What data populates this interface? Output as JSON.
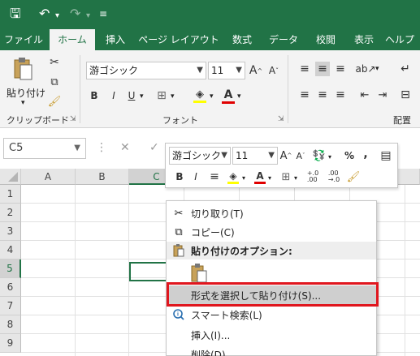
{
  "tabs": [
    "ファイル",
    "ホーム",
    "挿入",
    "ページ レイアウト",
    "数式",
    "データ",
    "校閲",
    "表示",
    "ヘルプ"
  ],
  "ribbon": {
    "paste_label": "貼り付け",
    "clipboard_group": "クリップボード",
    "font_group": "フォント",
    "align_group": "配置",
    "font_name": "游ゴシック",
    "font_size": "11",
    "bold": "B",
    "italic": "I",
    "underline": "U",
    "grow": "A",
    "shrink": "A"
  },
  "formula_bar": {
    "name_box": "C5"
  },
  "grid": {
    "columns": [
      "A",
      "B",
      "C"
    ],
    "rows": [
      "1",
      "2",
      "3",
      "4",
      "5",
      "6",
      "7",
      "8",
      "9"
    ],
    "selected_column": "C",
    "selected_row": "5"
  },
  "mini_toolbar": {
    "font_name": "游ゴシック",
    "font_size": "11",
    "bold": "B",
    "italic": "I",
    "percent": "%",
    "comma": ",",
    "inc_decimal": "+.0\n.00",
    "dec_decimal": ".00\n→.0"
  },
  "context_menu": {
    "items": [
      {
        "label": "切り取り(T)",
        "icon": "scissors-icon"
      },
      {
        "label": "コピー(C)",
        "icon": "copy-icon"
      },
      {
        "label": "貼り付けのオプション:",
        "icon": "paste-icon",
        "header": true
      },
      {
        "label": "",
        "icon": "paste-clipboard-icon"
      },
      {
        "label": "形式を選択して貼り付け(S)...",
        "icon": "",
        "highlighted": true
      },
      {
        "label": "スマート検索(L)",
        "icon": "smart-lookup-icon"
      },
      {
        "label": "挿入(I)...",
        "icon": ""
      },
      {
        "label": "削除(D)...",
        "icon": ""
      }
    ]
  },
  "colors": {
    "brand": "#217346",
    "highlight_outline": "#e0161e"
  }
}
